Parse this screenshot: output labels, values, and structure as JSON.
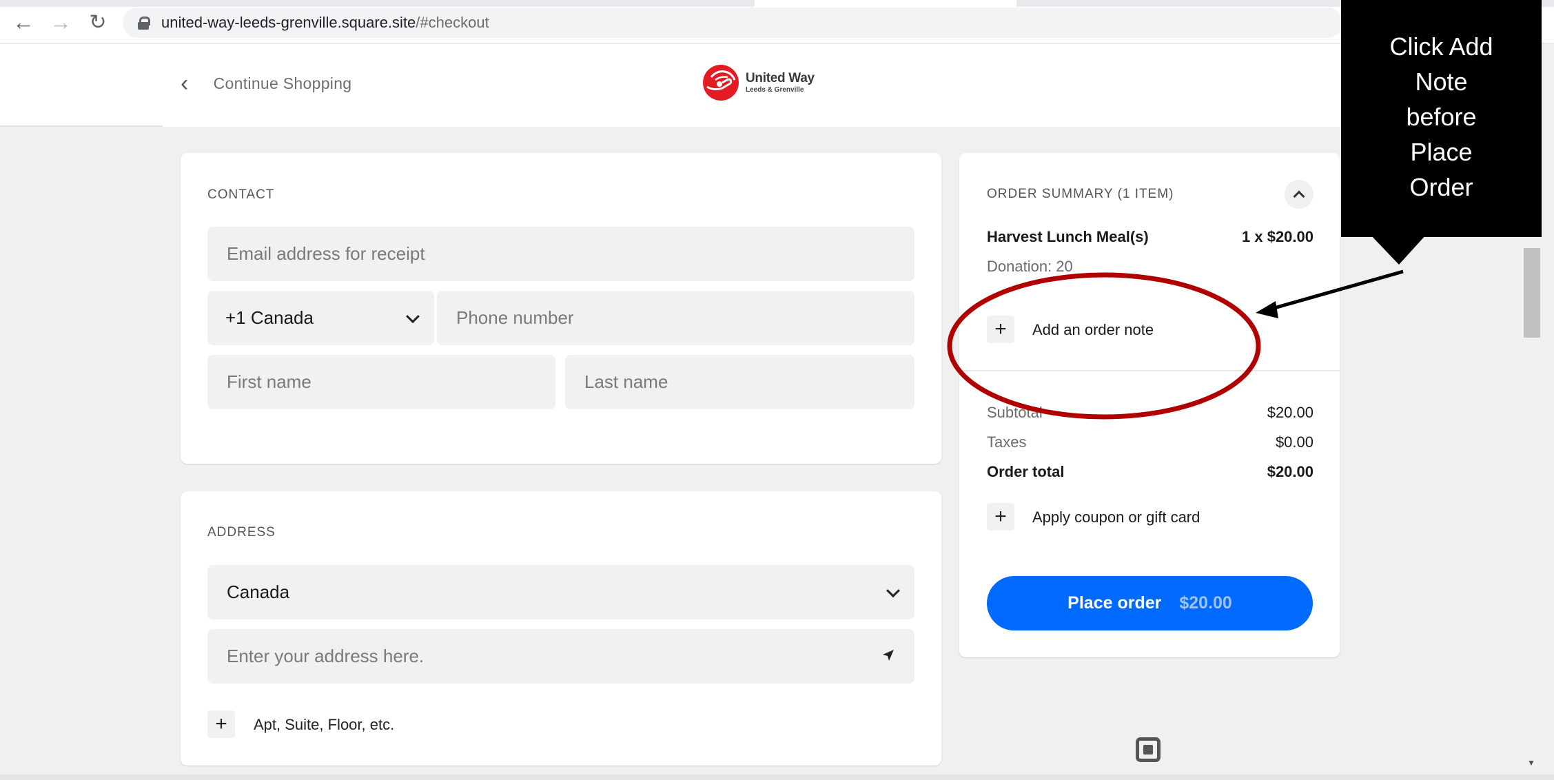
{
  "browser": {
    "url_host": "united-way-leeds-grenville.square.site",
    "url_path": "/#checkout",
    "back_icon": "arrow-left-icon",
    "forward_icon": "arrow-right-icon",
    "reload_icon": "reload-icon",
    "lock_icon": "lock-icon"
  },
  "header": {
    "continue_label": "Continue Shopping",
    "logo_line1": "United Way",
    "logo_line2": "Leeds & Grenville",
    "brand_color": "#e31b23"
  },
  "contact": {
    "title": "CONTACT",
    "email_placeholder": "Email address for receipt",
    "country_code": "+1 Canada",
    "phone_placeholder": "Phone number",
    "first_name_placeholder": "First name",
    "last_name_placeholder": "Last name"
  },
  "address": {
    "title": "ADDRESS",
    "country": "Canada",
    "address_placeholder": "Enter your address here.",
    "apt_label": "Apt, Suite, Floor, etc."
  },
  "summary": {
    "title": "ORDER SUMMARY (1 ITEM)",
    "item_name": "Harvest Lunch Meal(s)",
    "item_qty_price": "1 x $20.00",
    "item_detail": "Donation: 20",
    "add_note_label": "Add an order note",
    "subtotal_label": "Subtotal",
    "subtotal_value": "$20.00",
    "taxes_label": "Taxes",
    "taxes_value": "$0.00",
    "total_label": "Order total",
    "total_value": "$20.00",
    "coupon_label": "Apply coupon or gift card",
    "place_order_label": "Place order",
    "place_order_amount": "$20.00",
    "button_color": "#006aff"
  },
  "annotation": {
    "callout_line1": "Click Add",
    "callout_line2": "Note",
    "callout_line3": "before",
    "callout_line4": "Place",
    "callout_line5": "Order",
    "highlight_color": "#b00000"
  }
}
